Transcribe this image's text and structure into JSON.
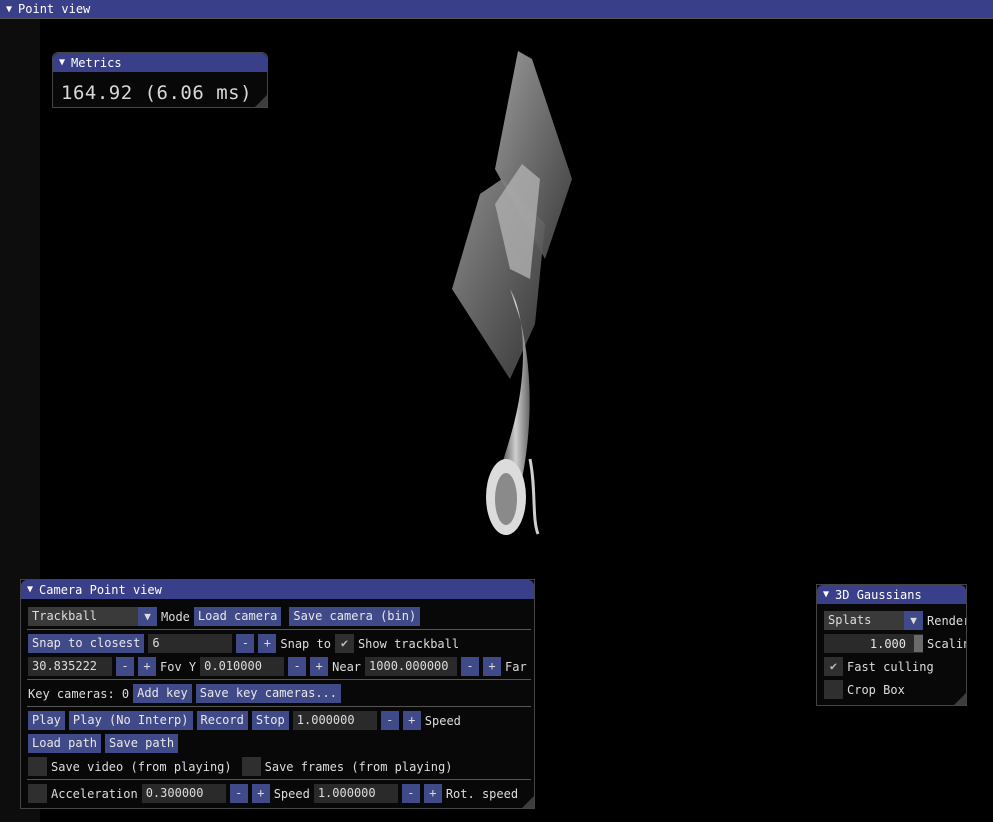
{
  "main_window": {
    "title": "Point view"
  },
  "metrics": {
    "title": "Metrics",
    "value": "164.92 (6.06 ms)"
  },
  "camera": {
    "title": "Camera Point view",
    "mode_value": "Trackball",
    "mode_label": "Mode",
    "load_camera": "Load camera",
    "save_camera": "Save camera (bin)",
    "snap_to_closest": "Snap to closest",
    "snap_value": "6",
    "snap_to_label": "Snap to",
    "show_trackball": "Show trackball",
    "fov_value": "30.835222",
    "fov_label": "Fov Y",
    "near_value": "0.010000",
    "near_label": "Near",
    "far_value": "1000.000000",
    "far_label": "Far",
    "key_cameras": "Key cameras: 0",
    "add_key": "Add key",
    "save_key_cameras": "Save key cameras...",
    "play": "Play",
    "play_no_interp": "Play (No Interp)",
    "record": "Record",
    "stop": "Stop",
    "speed_value": "1.000000",
    "speed_label": "Speed",
    "load_path": "Load path",
    "save_path": "Save path",
    "save_video": "Save video (from playing)",
    "save_frames": "Save frames (from playing)",
    "acceleration_label": "Acceleration",
    "acceleration_value": "0.300000",
    "speed2_label": "Speed",
    "speed2_value": "1.000000",
    "rot_speed_label": "Rot. speed",
    "minus": "-",
    "plus": "+"
  },
  "gaussians": {
    "title": "3D Gaussians",
    "render_value": "Splats",
    "render_label": "Render",
    "scaling_value": "1.000",
    "scaling_label": "Scaling",
    "fast_culling": "Fast culling",
    "crop_box": "Crop Box"
  },
  "icons": {
    "collapse": "▼",
    "combo_arrow": "▼",
    "check": "✔"
  }
}
